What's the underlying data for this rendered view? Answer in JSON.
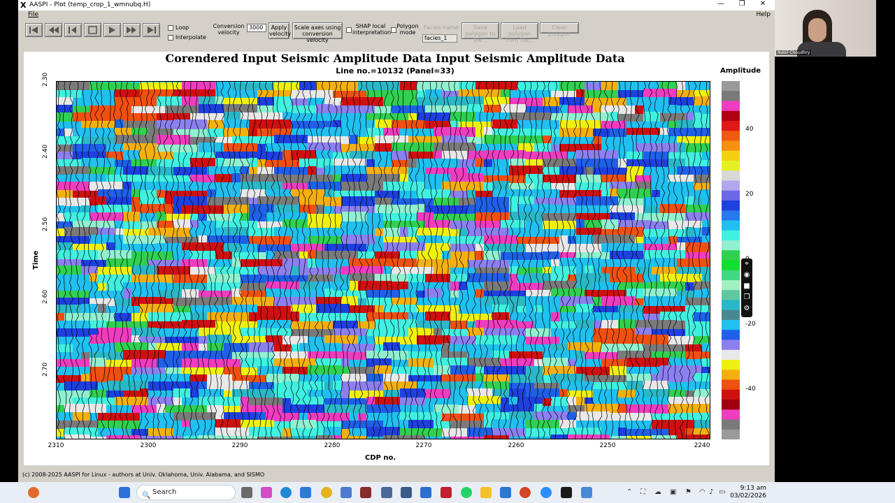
{
  "window": {
    "title": "AASPI - Plot (temp_crop_1_wmnubq.H)",
    "controls": [
      "—",
      "❐",
      "✕"
    ]
  },
  "menu": {
    "file": "File",
    "help": "Help"
  },
  "toolbar": {
    "loop": "Loop",
    "interpolate": "Interpolate",
    "conversion_velocity_label": "Conversion velocity",
    "velocity_value": "3000",
    "apply_velocity": "Apply velocity",
    "scale_axes": "Scale axes using conversion velocity",
    "shap": "SHAP local interpretation",
    "polygon_mode": "Polygon mode",
    "facies_name_label": "Facies name:",
    "facies_value": "facies_1",
    "save_polygon": "Save polygon to file...",
    "load_polygon": "Load polygon from file...",
    "clear_polygon": "Clear polygon"
  },
  "plot": {
    "title": "Corendered Input Seismic Amplitude Data Input Seismic Amplitude Data",
    "subtitle": "Line no.=10132 (Panel=33)",
    "ylabel": "Time",
    "xlabel": "CDP no.",
    "yticks": [
      "2.30",
      "2.40",
      "2.50",
      "2.60",
      "2.70"
    ],
    "xticks": [
      "2310",
      "2300",
      "2290",
      "2280",
      "2270",
      "2260",
      "2250",
      "2240"
    ],
    "colorbar_title": "Amplitude",
    "colorbar_ticks": [
      "40",
      "20",
      "0",
      "-20",
      "-40"
    ]
  },
  "colorbar_colors": [
    "#9a9a9a",
    "#7a7a7a",
    "#f03cc0",
    "#b00010",
    "#e01818",
    "#f05a10",
    "#f59010",
    "#f5d010",
    "#e6f020",
    "#d8d8d8",
    "#b3a8f0",
    "#6c68e8",
    "#1e40e0",
    "#2878f0",
    "#20c0f0",
    "#40f0e0",
    "#90f0d0",
    "#30d050",
    "#10e030",
    "#40d880",
    "#a0f0c0",
    "#60c8a0",
    "#2ab8c8",
    "#4a8890",
    "#20c0f0",
    "#1e60e8",
    "#8c80f0",
    "#e8e8e8",
    "#f0f010",
    "#f5b010",
    "#f05010",
    "#d01010",
    "#a00010",
    "#f03cc0",
    "#7a7a7a",
    "#9a9a9a"
  ],
  "statusbar": "(c) 2008-2025 AASPI for Linux - authors at Univ. Oklahoma, Univ. Alabama, and SISMO",
  "webcam": {
    "name": "Nabil Choudhry"
  },
  "taskbar": {
    "search": "Search",
    "time": "9:13 am",
    "date": "03/02/2026"
  }
}
